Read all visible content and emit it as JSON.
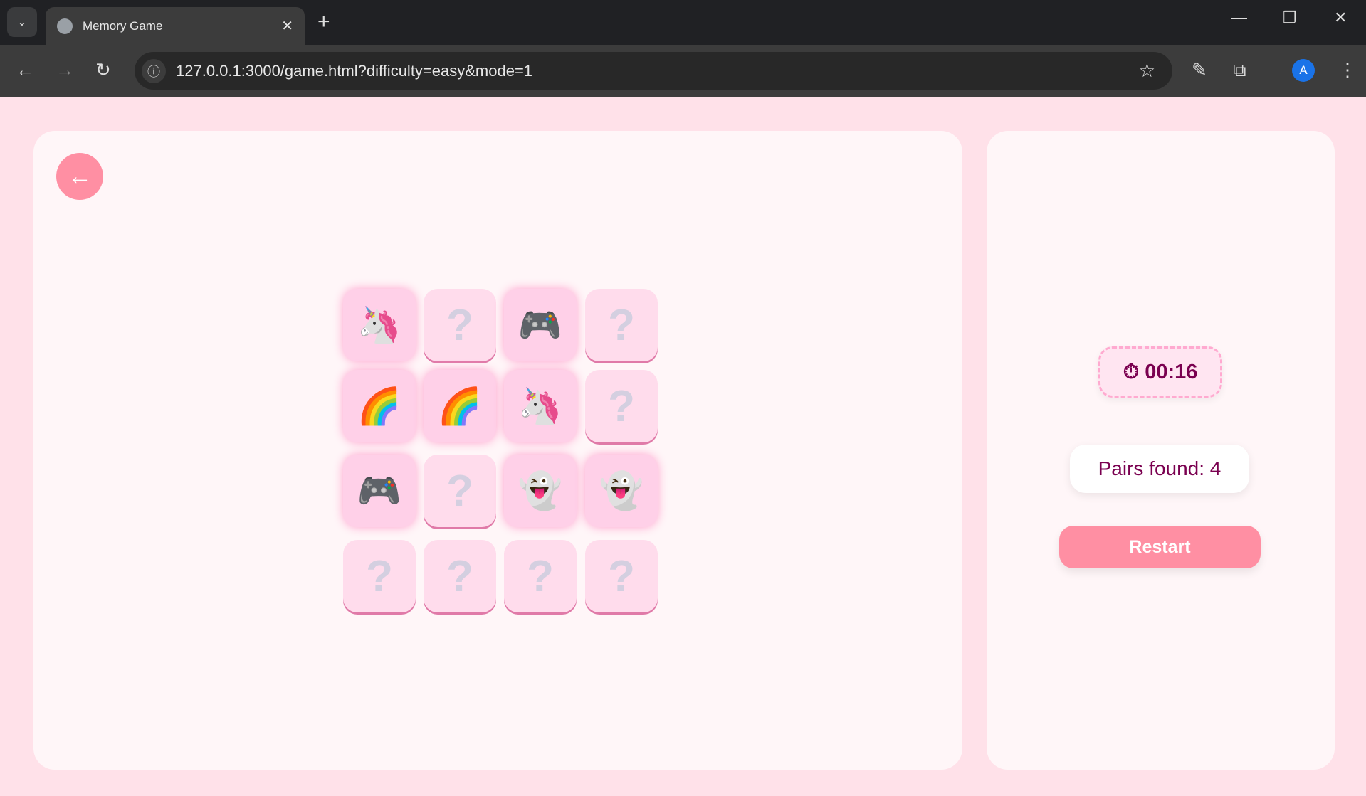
{
  "browser": {
    "tab_title": "Memory Game",
    "url": "127.0.0.1:3000/game.html?difficulty=easy&mode=1",
    "avatar_letter": "A"
  },
  "game": {
    "back_icon": "←",
    "cards": [
      {
        "face": "🦄",
        "flipped": true
      },
      {
        "face": "?",
        "flipped": false
      },
      {
        "face": "🎮",
        "flipped": true
      },
      {
        "face": "?",
        "flipped": false
      },
      {
        "face": "🌈",
        "flipped": true
      },
      {
        "face": "🌈",
        "flipped": true
      },
      {
        "face": "🦄",
        "flipped": true
      },
      {
        "face": "?",
        "flipped": false
      },
      {
        "face": "🎮",
        "flipped": true
      },
      {
        "face": "?",
        "flipped": false
      },
      {
        "face": "👻",
        "flipped": true
      },
      {
        "face": "👻",
        "flipped": true
      },
      {
        "face": "?",
        "flipped": false
      },
      {
        "face": "?",
        "flipped": false
      },
      {
        "face": "?",
        "flipped": false
      },
      {
        "face": "?",
        "flipped": false
      }
    ]
  },
  "sidebar": {
    "timer_icon": "⏱",
    "timer": "00:16",
    "pairs_found": "Pairs found: 4",
    "restart_label": "Restart"
  },
  "colors": {
    "accent": "#ff8fa3",
    "text": "#7a0050",
    "background": "#ffe1e9"
  }
}
